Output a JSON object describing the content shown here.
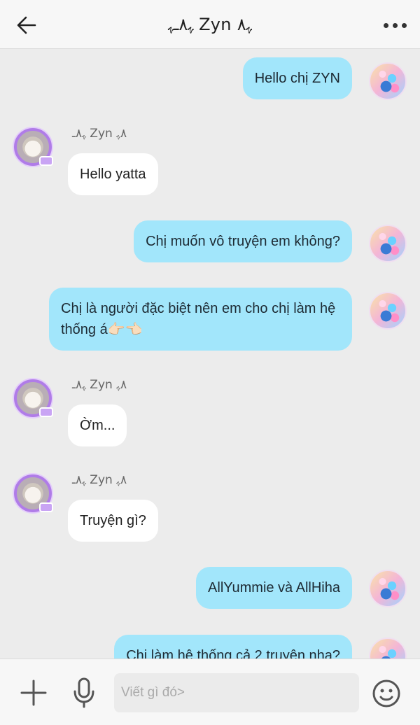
{
  "header": {
    "title": "ﮩ٨ـﮩ Zyn ﮩ٨",
    "back_icon": "arrow-left-icon",
    "more_icon": "more-dots-icon"
  },
  "messages": [
    {
      "from": "me",
      "text": "Hello chị ZYN"
    },
    {
      "from": "them",
      "sender": "ﮩ٨ـ Zyn ٨ﮩ",
      "text": "Hello yatta"
    },
    {
      "from": "me",
      "text": "Chị muốn vô truyện em không?"
    },
    {
      "from": "me",
      "text": "Chị là người đặc biệt nên em cho chị làm hệ thống á👉🏻👈🏻"
    },
    {
      "from": "them",
      "sender": "ﮩ٨ـ Zyn ٨ﮩ",
      "text": "Ờm..."
    },
    {
      "from": "them",
      "sender": "ﮩ٨ـ Zyn ٨ﮩ",
      "text": "Truyện gì?"
    },
    {
      "from": "me",
      "text": "AllYummie và AllHiha"
    },
    {
      "from": "me",
      "text": "Chị làm hệ thống cả 2 truyện nha?"
    }
  ],
  "input": {
    "placeholder": "Viết gì đó>",
    "value": ""
  },
  "icons": {
    "plus": "plus-icon",
    "mic": "microphone-icon",
    "emoji": "emoji-icon"
  },
  "colors": {
    "outgoing_bubble": "#a2e6fb",
    "incoming_bubble": "#ffffff",
    "background": "#ececec"
  }
}
